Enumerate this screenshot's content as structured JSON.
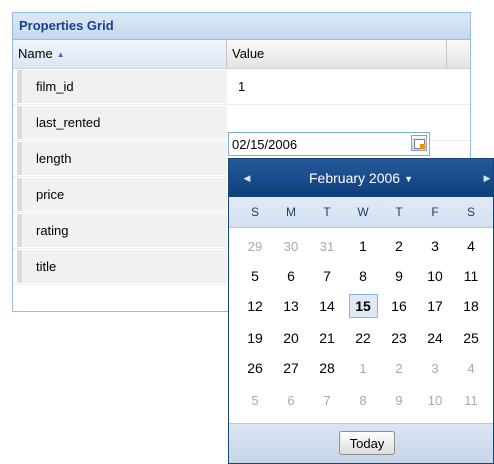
{
  "panel": {
    "title": "Properties Grid"
  },
  "columns": {
    "name": "Name",
    "value": "Value",
    "sort_icon": "sort-asc-icon"
  },
  "rows": [
    {
      "name": "film_id",
      "value": "1"
    },
    {
      "name": "last_rented",
      "value": ""
    },
    {
      "name": "length",
      "value": ""
    },
    {
      "name": "price",
      "value": ""
    },
    {
      "name": "rating",
      "value": ""
    },
    {
      "name": "title",
      "value": ""
    }
  ],
  "editor": {
    "value": "02/15/2006",
    "trigger_icon": "calendar-icon"
  },
  "datepicker": {
    "month_label": "February 2006",
    "prev_icon": "arrow-left-icon",
    "next_icon": "arrow-right-icon",
    "days": [
      "S",
      "M",
      "T",
      "W",
      "T",
      "F",
      "S"
    ],
    "weeks": [
      [
        {
          "d": "29",
          "o": true
        },
        {
          "d": "30",
          "o": true
        },
        {
          "d": "31",
          "o": true
        },
        {
          "d": "1"
        },
        {
          "d": "2"
        },
        {
          "d": "3"
        },
        {
          "d": "4"
        }
      ],
      [
        {
          "d": "5"
        },
        {
          "d": "6"
        },
        {
          "d": "7"
        },
        {
          "d": "8"
        },
        {
          "d": "9"
        },
        {
          "d": "10"
        },
        {
          "d": "11"
        }
      ],
      [
        {
          "d": "12"
        },
        {
          "d": "13"
        },
        {
          "d": "14"
        },
        {
          "d": "15",
          "sel": true
        },
        {
          "d": "16"
        },
        {
          "d": "17"
        },
        {
          "d": "18"
        }
      ],
      [
        {
          "d": "19"
        },
        {
          "d": "20"
        },
        {
          "d": "21"
        },
        {
          "d": "22"
        },
        {
          "d": "23"
        },
        {
          "d": "24"
        },
        {
          "d": "25"
        }
      ],
      [
        {
          "d": "26"
        },
        {
          "d": "27"
        },
        {
          "d": "28"
        },
        {
          "d": "1",
          "o": true
        },
        {
          "d": "2",
          "o": true
        },
        {
          "d": "3",
          "o": true
        },
        {
          "d": "4",
          "o": true
        }
      ],
      [
        {
          "d": "5",
          "o": true
        },
        {
          "d": "6",
          "o": true
        },
        {
          "d": "7",
          "o": true
        },
        {
          "d": "8",
          "o": true
        },
        {
          "d": "9",
          "o": true
        },
        {
          "d": "10",
          "o": true
        },
        {
          "d": "11",
          "o": true
        }
      ]
    ],
    "today_label": "Today"
  }
}
